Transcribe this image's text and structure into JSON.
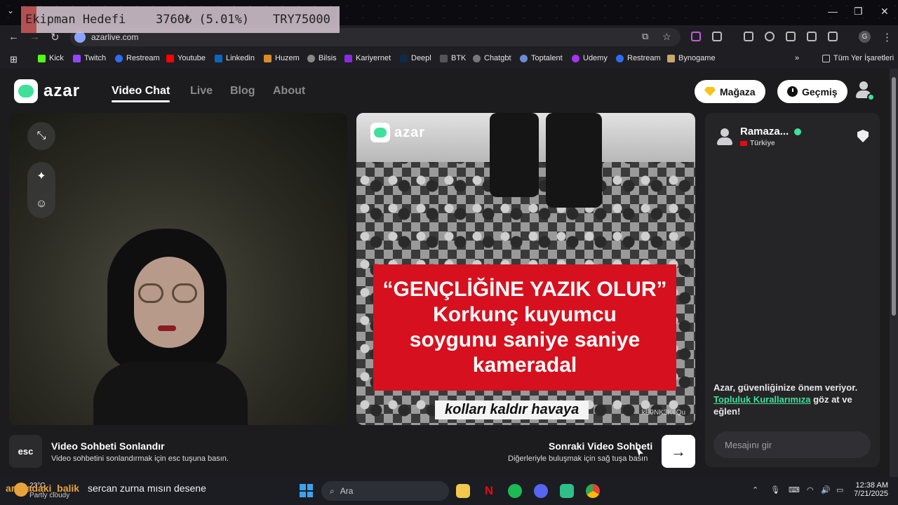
{
  "overlay": {
    "label": "Ekipman Hedefi",
    "progress": "3760₺ (5.01%)",
    "goal": "TRY75000"
  },
  "browser": {
    "url": "azarlive.com",
    "bookmarks": [
      "Kick",
      "Twitch",
      "Restream",
      "Youtube",
      "Linkedin",
      "Huzem",
      "Bilsis",
      "Kariyernet",
      "Deepl",
      "BTK",
      "Chatgbt",
      "Toptalent",
      "Udemy",
      "Restream",
      "Bynogame"
    ],
    "all_bookmarks": "Tüm Yer İşaretleri",
    "profile_initial": "G"
  },
  "site": {
    "logo": "azar",
    "nav": [
      "Video Chat",
      "Live",
      "Blog",
      "About"
    ],
    "store": "Mağaza",
    "history": "Geçmiş"
  },
  "remote_video": {
    "watermark": "azar",
    "headline": "“GENÇLİĞİNE YAZIK OLUR”",
    "subline1": "Korkunç kuyumcu",
    "subline2": "soygunu saniye saniye",
    "subline3": "kameradal",
    "caption": "kolları kaldır havaya",
    "id": "kE9NK3K6Qu"
  },
  "chat": {
    "user": "Ramaza...",
    "country": "Türkiye",
    "safety_text": "Azar, güvenliğinize önem veriyor.",
    "safety_link": "Topluluk Kurallarımıza",
    "safety_tail": "göz at ve eğlen!",
    "input_placeholder": "Mesajını gir"
  },
  "controls": {
    "esc_key": "esc",
    "end_title": "Video Sohbeti Sonlandır",
    "end_sub": "Video sohbetini sonlandırmak için esc tuşuna basın.",
    "next_title": "Sonraki Video Sohbeti",
    "next_sub": "Diğerleriyle buluşmak için sağ tuşa basın",
    "next_arrow": "→"
  },
  "taskbar": {
    "weather_temp": "23°C",
    "weather_desc": "Partly cloudy",
    "stream_user": "arabadaki_balik",
    "stream_msg": "sercan zurna mısın desene",
    "search": "Ara",
    "time": "12:38 AM",
    "date": "7/21/2025"
  },
  "colors": {
    "accent": "#3fe19a",
    "news_red": "#d6101e",
    "background": "#1c1c1e"
  }
}
